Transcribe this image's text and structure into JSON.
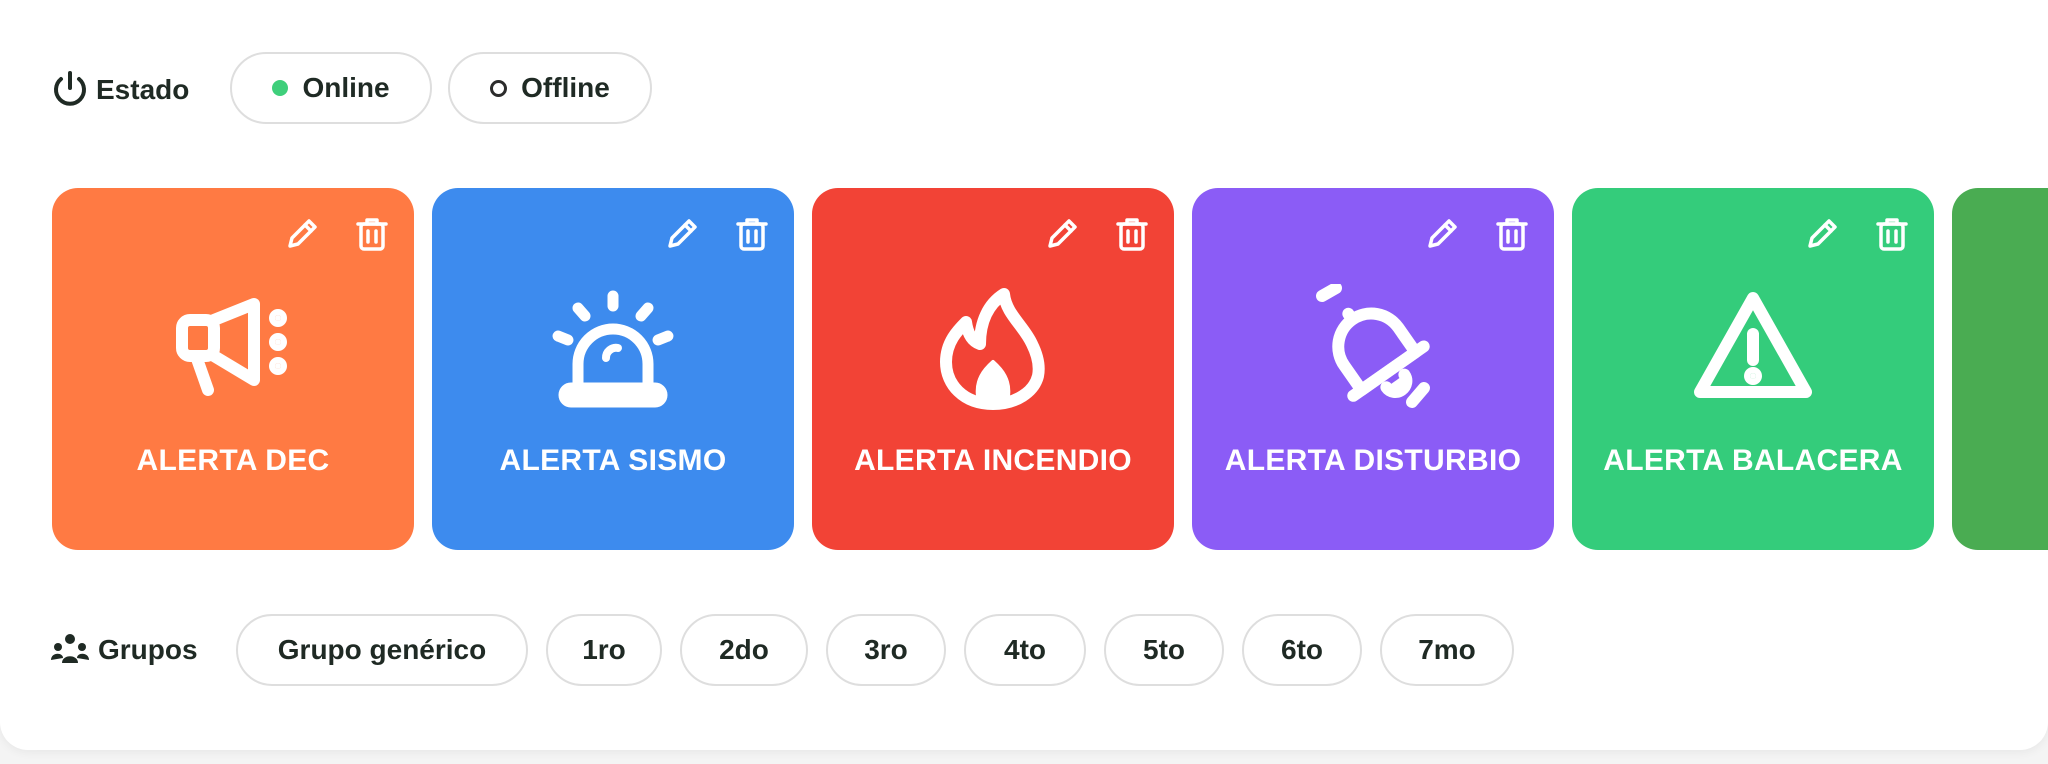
{
  "estado": {
    "label": "Estado",
    "options": [
      {
        "label": "Online",
        "status": "online",
        "color": "#3fcf7b"
      },
      {
        "label": "Offline",
        "status": "offline"
      }
    ]
  },
  "alerts": [
    {
      "title": "ALERTA DEC",
      "color": "#ff7a43",
      "icon": "megaphone-icon"
    },
    {
      "title": "ALERTA SISMO",
      "color": "#3d8bee",
      "icon": "siren-icon"
    },
    {
      "title": "ALERTA INCENDIO",
      "color": "#f24336",
      "icon": "fire-icon"
    },
    {
      "title": "ALERTA DISTURBIO",
      "color": "#8b5cf6",
      "icon": "bell-off-icon"
    },
    {
      "title": "ALERTA BALACERA",
      "color": "#34cc7b",
      "icon": "warning-icon"
    },
    {
      "title": "",
      "color": "#4aac52",
      "icon": ""
    }
  ],
  "grupos": {
    "label": "Grupos",
    "items": [
      "Grupo genérico",
      "1ro",
      "2do",
      "3ro",
      "4to",
      "5to",
      "6to",
      "7mo"
    ]
  }
}
